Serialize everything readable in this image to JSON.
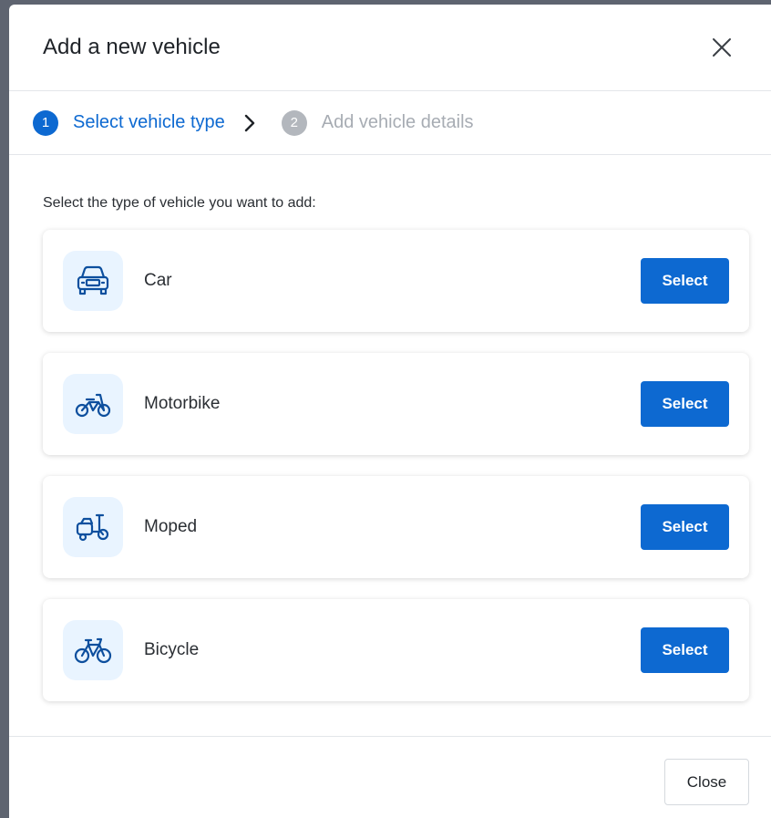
{
  "dialog": {
    "title": "Add a new vehicle",
    "close_icon": "close-icon"
  },
  "stepper": {
    "steps": [
      {
        "number": "1",
        "label": "Select vehicle type",
        "state": "active"
      },
      {
        "number": "2",
        "label": "Add vehicle details",
        "state": "inactive"
      }
    ],
    "separator_icon": "chevron-right-icon"
  },
  "content": {
    "instruction": "Select the type of vehicle you want to add:",
    "vehicles": [
      {
        "label": "Car",
        "icon": "car-icon",
        "button": "Select"
      },
      {
        "label": "Motorbike",
        "icon": "motorbike-icon",
        "button": "Select"
      },
      {
        "label": "Moped",
        "icon": "moped-icon",
        "button": "Select"
      },
      {
        "label": "Bicycle",
        "icon": "bicycle-icon",
        "button": "Select"
      }
    ]
  },
  "footer": {
    "close_label": "Close"
  },
  "colors": {
    "accent": "#0d69d1",
    "icon_tile": "#e9f4ff",
    "inactive": "#a7acb3"
  }
}
